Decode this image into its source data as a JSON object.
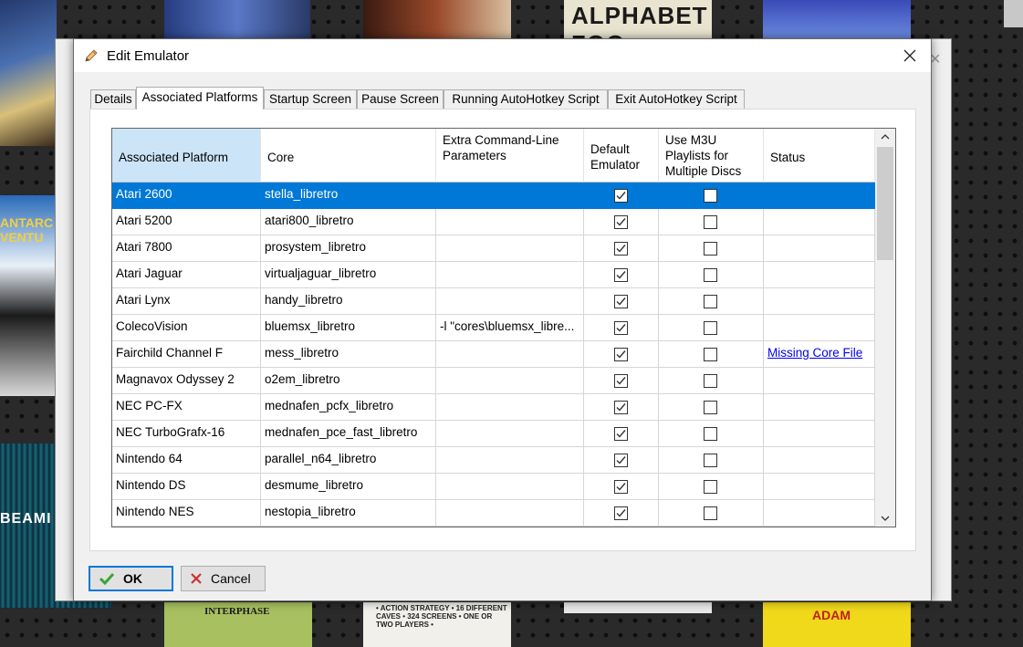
{
  "background_text": {
    "cover_4": "ALPHABET ZOO",
    "cover_6": "ANTARC VENTU",
    "cover_7": "BEAMI",
    "cover_8": "INTERPHASE",
    "cover_9": "• ACTION STRATEGY • 16 DIFFERENT CAVES • 324 SCREENS • ONE OR TWO PLAYERS •",
    "cover_11": "ADAM"
  },
  "dialog": {
    "title": "Edit Emulator",
    "tabs": [
      {
        "label": "Details"
      },
      {
        "label": "Associated Platforms"
      },
      {
        "label": "Startup Screen"
      },
      {
        "label": "Pause Screen"
      },
      {
        "label": "Running AutoHotkey Script"
      },
      {
        "label": "Exit AutoHotkey Script"
      }
    ],
    "active_tab": "Associated Platforms",
    "columns": [
      {
        "label": "Associated Platform"
      },
      {
        "label": "Core"
      },
      {
        "label": "Extra Command-Line Parameters"
      },
      {
        "label": "Default Emulator"
      },
      {
        "label": "Use M3U Playlists for Multiple Discs"
      },
      {
        "label": "Status"
      }
    ],
    "rows": [
      {
        "platform": "Atari 2600",
        "core": "stella_libretro",
        "params": "",
        "default": true,
        "m3u": false,
        "status": ""
      },
      {
        "platform": "Atari 5200",
        "core": "atari800_libretro",
        "params": "",
        "default": true,
        "m3u": false,
        "status": ""
      },
      {
        "platform": "Atari 7800",
        "core": "prosystem_libretro",
        "params": "",
        "default": true,
        "m3u": false,
        "status": ""
      },
      {
        "platform": "Atari Jaguar",
        "core": "virtualjaguar_libretro",
        "params": "",
        "default": true,
        "m3u": false,
        "status": ""
      },
      {
        "platform": "Atari Lynx",
        "core": "handy_libretro",
        "params": "",
        "default": true,
        "m3u": false,
        "status": ""
      },
      {
        "platform": "ColecoVision",
        "core": "bluemsx_libretro",
        "params": "-l \"cores\\bluemsx_libre...",
        "default": true,
        "m3u": false,
        "status": ""
      },
      {
        "platform": "Fairchild Channel F",
        "core": "mess_libretro",
        "params": "",
        "default": true,
        "m3u": false,
        "status": "Missing Core File"
      },
      {
        "platform": "Magnavox Odyssey 2",
        "core": "o2em_libretro",
        "params": "",
        "default": true,
        "m3u": false,
        "status": ""
      },
      {
        "platform": "NEC PC-FX",
        "core": "mednafen_pcfx_libretro",
        "params": "",
        "default": true,
        "m3u": false,
        "status": ""
      },
      {
        "platform": "NEC TurboGrafx-16",
        "core": "mednafen_pce_fast_libretro",
        "params": "",
        "default": true,
        "m3u": false,
        "status": ""
      },
      {
        "platform": "Nintendo 64",
        "core": "parallel_n64_libretro",
        "params": "",
        "default": true,
        "m3u": false,
        "status": ""
      },
      {
        "platform": "Nintendo DS",
        "core": "desmume_libretro",
        "params": "",
        "default": true,
        "m3u": false,
        "status": ""
      },
      {
        "platform": "Nintendo NES",
        "core": "nestopia_libretro",
        "params": "",
        "default": true,
        "m3u": false,
        "status": ""
      }
    ],
    "selected_row": 0,
    "buttons": {
      "ok": "OK",
      "cancel": "Cancel"
    }
  },
  "colors": {
    "selection": "#0078d7",
    "header_selected": "#cce4f7",
    "link": "#0000ee",
    "ok_icon": "#3aa53a",
    "cancel_icon": "#d03030"
  },
  "icons": {
    "title": "pencil-icon",
    "close": "close-icon",
    "ok": "checkmark-icon",
    "cancel": "x-icon",
    "scroll_up": "chevron-up-icon",
    "scroll_down": "chevron-down-icon"
  }
}
